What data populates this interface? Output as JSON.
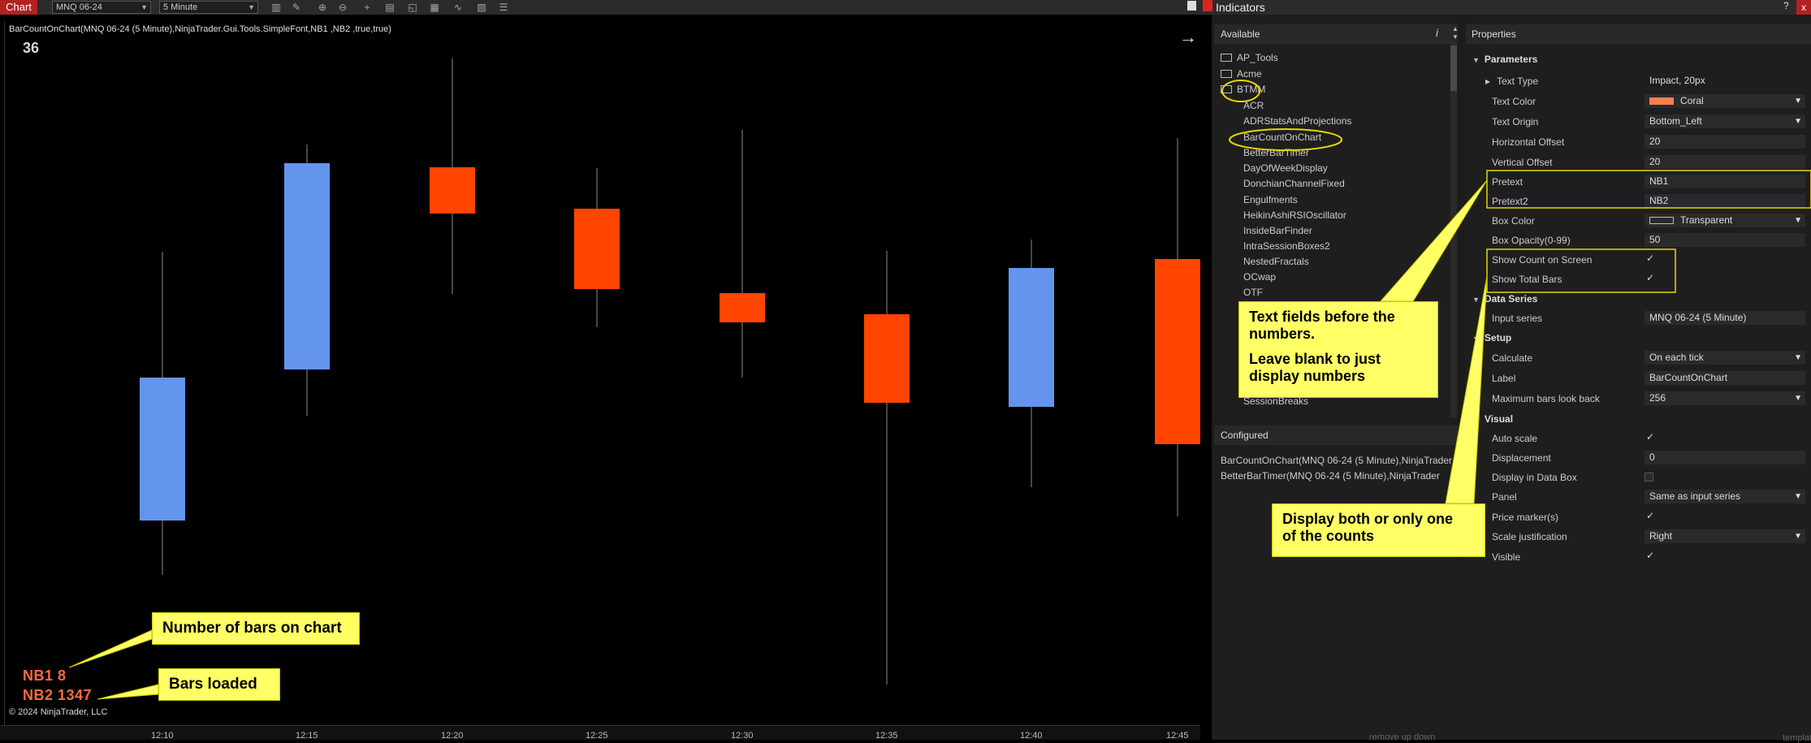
{
  "chart": {
    "tab": "Chart",
    "instrument": "MNQ 06-24",
    "interval": "5 Minute",
    "info_line": "BarCountOnChart(MNQ 06-24 (5 Minute),NinjaTrader.Gui.Tools.SimpleFont,NB1 ,NB2 ,true,true)",
    "bar_count": "36",
    "nb1": "NB1 8",
    "nb2": "NB2 1347",
    "copyright": "© 2024 NinjaTrader, LLC",
    "x_labels": [
      "12:10",
      "12:15",
      "12:20",
      "12:25",
      "12:30",
      "12:35",
      "12:40",
      "12:45"
    ],
    "colors": {
      "up": "#6495ed",
      "down": "#ff4500",
      "wick": "#8c8c8c",
      "text": "#ff6a3d"
    }
  },
  "annotations": {
    "bars_on_chart": "Number of bars on chart",
    "bars_loaded": "Bars loaded",
    "text_fields_1": "Text fields before the",
    "text_fields_2": "numbers.",
    "leave_blank_1": "Leave blank to just",
    "leave_blank_2": "display numbers",
    "display_both_1": "Display both or only one",
    "display_both_2": "of the counts"
  },
  "indicators": {
    "title": "Indicators",
    "help": "?",
    "close": "x",
    "available_label": "Available",
    "info_icon": "i",
    "available_items": [
      {
        "label": "AP_Tools",
        "folder": true
      },
      {
        "label": "Acme",
        "folder": true
      },
      {
        "label": "BTMM",
        "folder": true
      },
      {
        "label": "ACR",
        "folder": false
      },
      {
        "label": "ADRStatsAndProjections",
        "folder": false
      },
      {
        "label": "BarCountOnChart",
        "folder": false
      },
      {
        "label": "BetterBarTimer",
        "folder": false
      },
      {
        "label": "DayOfWeekDisplay",
        "folder": false
      },
      {
        "label": "DonchianChannelFixed",
        "folder": false
      },
      {
        "label": "Engulfments",
        "folder": false
      },
      {
        "label": "HeikinAshiRSIOscillator",
        "folder": false
      },
      {
        "label": "InsideBarFinder",
        "folder": false
      },
      {
        "label": "IntraSessionBoxes2",
        "folder": false
      },
      {
        "label": "NestedFractals",
        "folder": false
      },
      {
        "label": "OCwap",
        "folder": false
      },
      {
        "label": "OTF",
        "folder": false
      }
    ],
    "available_last": "SessionBreaks",
    "configured_label": "Configured",
    "configured_items": [
      "BarCountOnChart(MNQ 06-24 (5 Minute),NinjaTrader",
      "BetterBarTimer(MNQ 06-24 (5 Minute),NinjaTrader"
    ],
    "config_footer": "remove   up   down",
    "properties_label": "Properties",
    "prop_footer": "template",
    "cat_parameters": "Parameters",
    "cat_data_series": "Data Series",
    "cat_setup": "Setup",
    "cat_visual": "Visual",
    "text_type_label": "Text Type",
    "text_type_value": "Impact, 20px",
    "text_color_label": "Text Color",
    "text_color_value": "Coral",
    "text_color_hex": "#ff7f50",
    "text_origin_label": "Text Origin",
    "text_origin_value": "Bottom_Left",
    "h_offset_label": "Horizontal Offset",
    "h_offset_value": "20",
    "v_offset_label": "Vertical Offset",
    "v_offset_value": "20",
    "pretext_label": "Pretext",
    "pretext_value": "NB1",
    "pretext2_label": "Pretext2",
    "pretext2_value": "NB2",
    "box_color_label": "Box Color",
    "box_color_value": "Transparent",
    "box_opacity_label": "Box Opacity(0-99)",
    "box_opacity_value": "50",
    "show_count_label": "Show Count on Screen",
    "show_total_label": "Show Total Bars",
    "input_series_label": "Input series",
    "input_series_value": "MNQ 06-24 (5 Minute)",
    "calculate_label": "Calculate",
    "calculate_value": "On each tick",
    "label_label": "Label",
    "label_value": "BarCountOnChart",
    "max_bars_label": "Maximum bars look back",
    "max_bars_value": "256",
    "auto_scale_label": "Auto scale",
    "displacement_label": "Displacement",
    "displacement_value": "0",
    "display_data_box_label": "Display in Data Box",
    "panel_label": "Panel",
    "panel_value": "Same as input series",
    "price_marker_label": "Price marker(s)",
    "scale_just_label": "Scale justification",
    "scale_just_value": "Right",
    "visible_label": "Visible",
    "check_mark": "✓"
  }
}
